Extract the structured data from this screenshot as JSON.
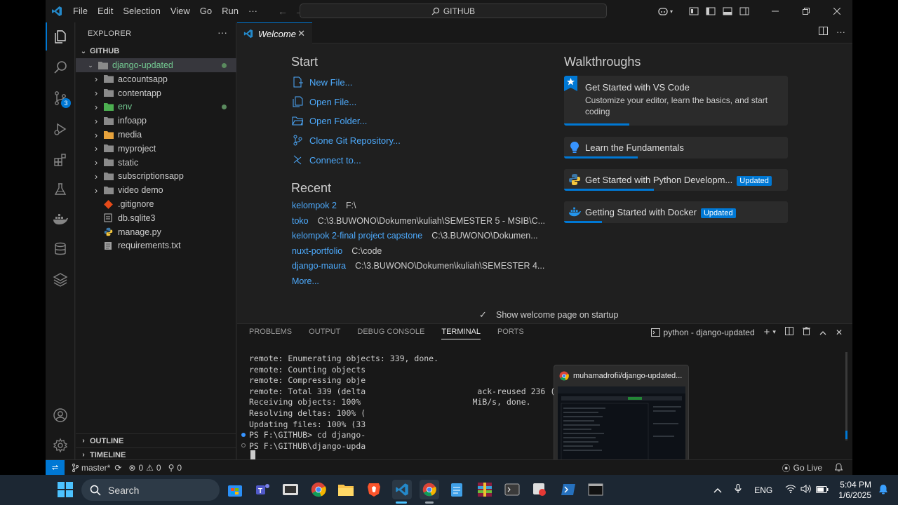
{
  "titlebar": {
    "menus": [
      "File",
      "Edit",
      "Selection",
      "View",
      "Go",
      "Run",
      "···"
    ],
    "search_text": "GITHUB"
  },
  "activity": {
    "scm_badge": "3"
  },
  "explorer": {
    "header": "EXPLORER",
    "more": "···",
    "root": "GITHUB",
    "items": [
      {
        "label": "django-updated",
        "type": "folder-open",
        "depth": 1
      },
      {
        "label": "accountsapp",
        "type": "folder",
        "depth": 2
      },
      {
        "label": "contentapp",
        "type": "folder",
        "depth": 2
      },
      {
        "label": "env",
        "type": "folder",
        "depth": 2
      },
      {
        "label": "infoapp",
        "type": "folder",
        "depth": 2
      },
      {
        "label": "media",
        "type": "folder",
        "depth": 2
      },
      {
        "label": "myproject",
        "type": "folder",
        "depth": 2
      },
      {
        "label": "static",
        "type": "folder",
        "depth": 2
      },
      {
        "label": "subscriptionsapp",
        "type": "folder",
        "depth": 2
      },
      {
        "label": "video demo",
        "type": "folder",
        "depth": 2
      },
      {
        "label": ".gitignore",
        "type": "git",
        "depth": 2
      },
      {
        "label": "db.sqlite3",
        "type": "db",
        "depth": 2
      },
      {
        "label": "manage.py",
        "type": "py",
        "depth": 2
      },
      {
        "label": "requirements.txt",
        "type": "txt",
        "depth": 2
      }
    ],
    "outline": "OUTLINE",
    "timeline": "TIMELINE"
  },
  "editor": {
    "tab_label": "Welcome",
    "start_title": "Start",
    "start_items": [
      "New File...",
      "Open File...",
      "Open Folder...",
      "Clone Git Repository...",
      "Connect to..."
    ],
    "recent_title": "Recent",
    "recent": [
      {
        "name": "kelompok 2",
        "path": "F:\\"
      },
      {
        "name": "toko",
        "path": "C:\\3.BUWONO\\Dokumen\\kuliah\\SEMESTER 5 - MSIB\\C..."
      },
      {
        "name": "kelompok 2-final project capstone",
        "path": "C:\\3.BUWONO\\Dokumen..."
      },
      {
        "name": "nuxt-portfolio",
        "path": "C:\\code"
      },
      {
        "name": "django-maura",
        "path": "C:\\3.BUWONO\\Dokumen\\kuliah\\SEMESTER 4..."
      }
    ],
    "more": "More...",
    "walk_title": "Walkthroughs",
    "walkthroughs": [
      {
        "title": "Get Started with VS Code",
        "desc": "Customize your editor, learn the basics, and start coding",
        "progress": 0.29
      },
      {
        "title": "Learn the Fundamentals",
        "progress": 0.33
      },
      {
        "title": "Get Started with Python Developm...",
        "badge": "Updated",
        "progress": 0.4
      },
      {
        "title": "Getting Started with Docker",
        "badge": "Updated",
        "progress": 0.17
      }
    ],
    "show_welcome": "Show welcome page on startup"
  },
  "panel": {
    "tabs": [
      "PROBLEMS",
      "OUTPUT",
      "DEBUG CONSOLE",
      "TERMINAL",
      "PORTS"
    ],
    "terminal_name": "python - django-updated",
    "lines": [
      "remote: Enumerating objects: 339, done.",
      "remote: Counting objects",
      "remote: Compressing obje",
      "remote: Total 339 (delta                       ack-reused 236 (from 1)",
      "Receiving objects: 100%                       MiB/s, done.",
      "Resolving deltas: 100% (",
      "Updating files: 100% (33",
      "PS F:\\GITHUB> cd django-",
      "PS F:\\GITHUB\\django-upda"
    ],
    "popup_title": "muhamadrofii/django-updated..."
  },
  "statusbar": {
    "branch": "master*",
    "errors": "0",
    "warnings": "0",
    "ports": "0",
    "golive": "Go Live"
  },
  "taskbar": {
    "search": "Search",
    "lang": "ENG",
    "time": "5:04 PM",
    "date": "1/6/2025"
  },
  "colors": {
    "accent": "#0078d4",
    "link": "#4daafc",
    "modified": "#73c991"
  }
}
